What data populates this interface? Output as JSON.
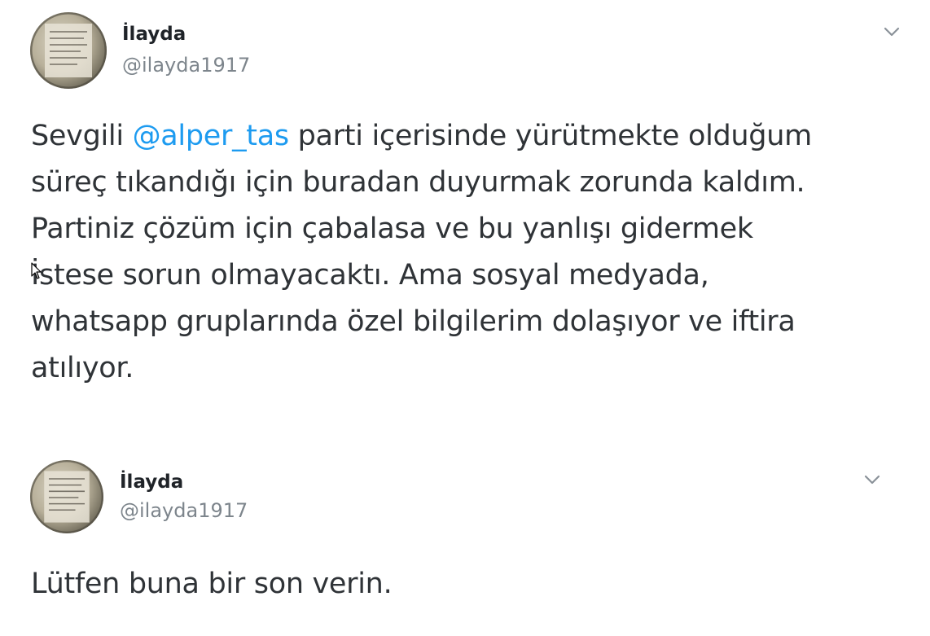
{
  "tweets": [
    {
      "author": {
        "display_name": "İlayda",
        "handle": "@ilayda1917",
        "avatar_icon": "profile-avatar"
      },
      "menu_icon": "chevron-down-icon",
      "text_lines": [
        {
          "before": "Sevgili ",
          "mention": "@alper_tas",
          "after": " parti içerisinde yürütmekte olduğum"
        },
        {
          "text": "süreç tıkandığı için buradan duyurmak zorunda kaldım."
        },
        {
          "text": "Partiniz çözüm için çabalasa ve bu yanlışı gidermek"
        },
        {
          "text": "İstese sorun olmayacaktı. Ama sosyal medyada,"
        },
        {
          "text": "whatsapp gruplarında özel bilgilerim dolaşıyor ve iftira"
        },
        {
          "text": "atılıyor."
        }
      ]
    },
    {
      "author": {
        "display_name": "İlayda",
        "handle": "@ilayda1917",
        "avatar_icon": "profile-avatar"
      },
      "menu_icon": "chevron-down-icon",
      "text_lines": [
        {
          "text": "Lütfen buna bir son verin."
        }
      ]
    }
  ],
  "colors": {
    "mention": "#1d9bf0",
    "text": "#2f3337",
    "handle": "#7d858c"
  }
}
